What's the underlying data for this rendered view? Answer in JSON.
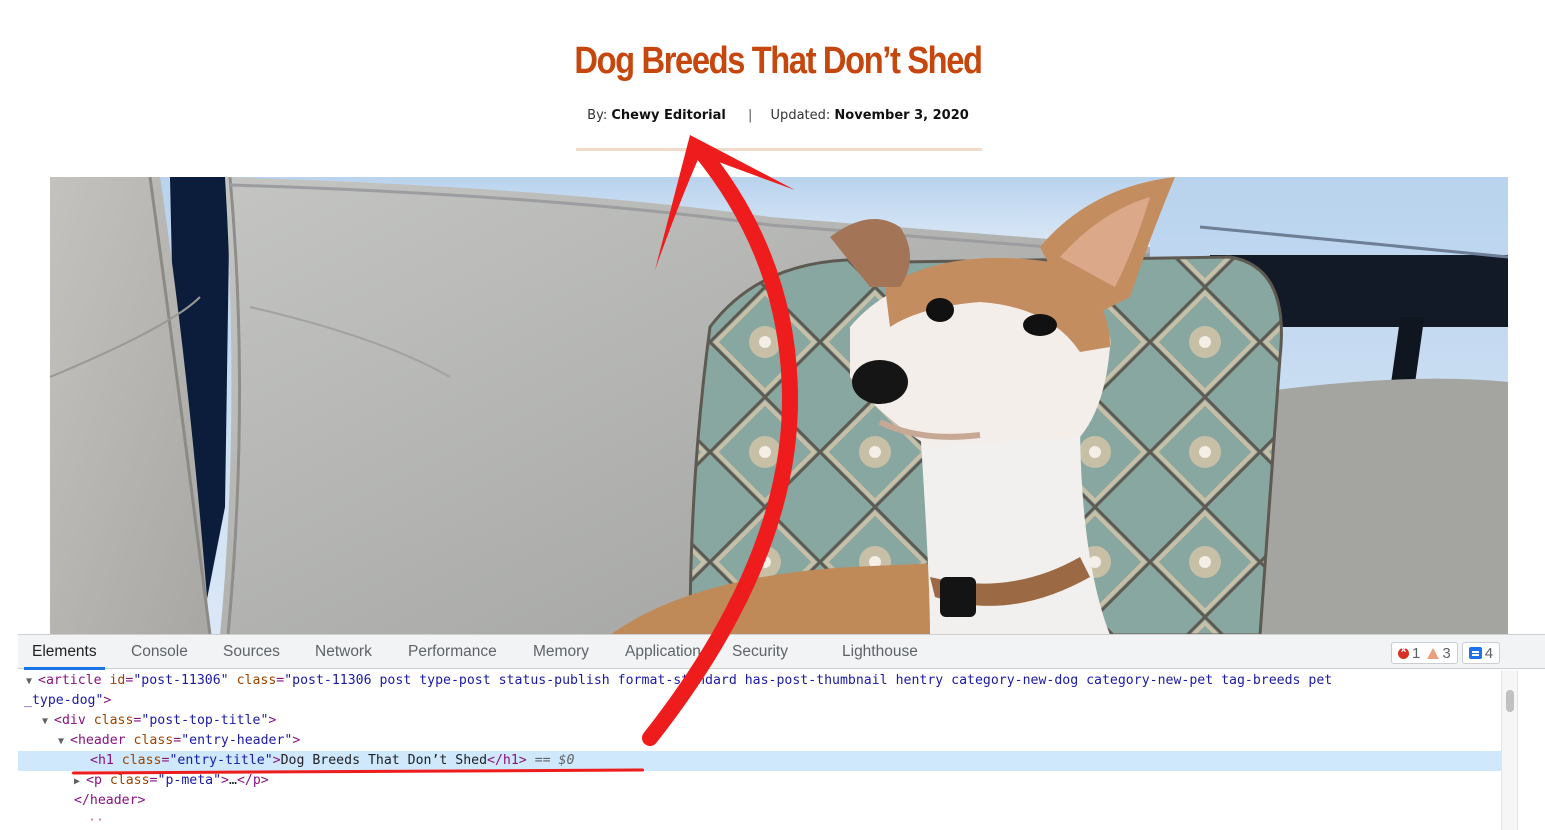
{
  "article": {
    "title": "Dog Breeds That Don’t Shed",
    "meta": {
      "by_label": "By:",
      "author": "Chewy Editorial",
      "separator": "|",
      "updated_label": "Updated:",
      "updated_date": "November 3, 2020"
    },
    "hero_image": {
      "description": "Italian greyhound sitting on a grey outdoor sofa next to a teal patterned pillow"
    }
  },
  "devtools": {
    "tabs": [
      {
        "label": "Elements",
        "active": true
      },
      {
        "label": "Console"
      },
      {
        "label": "Sources"
      },
      {
        "label": "Network"
      },
      {
        "label": "Performance"
      },
      {
        "label": "Memory"
      },
      {
        "label": "Application"
      },
      {
        "label": "Security"
      },
      {
        "label": "Lighthouse"
      }
    ],
    "badges": {
      "errors": "1",
      "warnings": "3",
      "messages": "4"
    },
    "dom_lines": [
      {
        "tag_open": "<article",
        "attr1": "id",
        "val1": "\"post-11306\"",
        "attr2": "class",
        "val2": "\"post-11306 post type-post status-publish format-standard has-post-thumbnail hentry category-new-dog category-new-pet tag-breeds pet",
        "continuation": "_type-dog\"",
        "tag_close": ">"
      },
      {
        "tag_open": "<div",
        "attr": "class",
        "val": "\"post-top-title\"",
        "tag_close": ">"
      },
      {
        "tag_open": "<header",
        "attr": "class",
        "val": "\"entry-header\"",
        "tag_close": ">"
      },
      {
        "tag_open": "<h1",
        "attr": "class",
        "val": "\"entry-title\"",
        "tag_close": ">",
        "text": "Dog Breeds That Don’t Shed",
        "end_tag": "</h1>",
        "console_ref": "== $0"
      },
      {
        "tag_open": "<p",
        "attr": "class",
        "val": "\"p-meta\"",
        "tag_close": ">",
        "ellipsis": "…",
        "end_tag": "</p>"
      },
      {
        "end_tag": "</header>"
      }
    ]
  },
  "annotation": {
    "arrow_color": "#ee1c1c",
    "meaning": "arrow from h1 DOM node to rendered title"
  }
}
